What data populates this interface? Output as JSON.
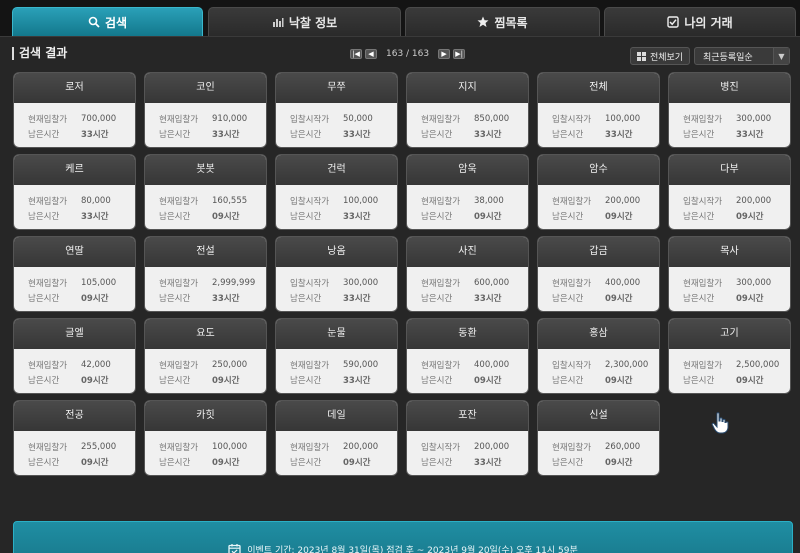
{
  "tabs": [
    {
      "label": "검색",
      "icon": "search-icon",
      "active": true
    },
    {
      "label": "낙찰 정보",
      "icon": "bar-chart-icon"
    },
    {
      "label": "찜목록",
      "icon": "star-icon"
    },
    {
      "label": "나의 거래",
      "icon": "checkbox-icon"
    }
  ],
  "panel": {
    "title": "검색 결과",
    "pager": {
      "text": "163 / 163",
      "first": "|◀",
      "prev": "◀",
      "next": "▶",
      "last": "▶|"
    },
    "view_all": "전체보기",
    "sort": "최근등록일순"
  },
  "items": [
    {
      "name": "로저",
      "price_label": "현재입찰가",
      "price": "700,000",
      "time_label": "남은시간",
      "time": "33시간"
    },
    {
      "name": "코인",
      "price_label": "현재입찰가",
      "price": "910,000",
      "time_label": "남은시간",
      "time": "33시간"
    },
    {
      "name": "무쭈",
      "price_label": "입찰시작가",
      "price": "50,000",
      "time_label": "남은시간",
      "time": "33시간"
    },
    {
      "name": "지지",
      "price_label": "현재입찰가",
      "price": "850,000",
      "time_label": "남은시간",
      "time": "33시간"
    },
    {
      "name": "전체",
      "price_label": "입찰시작가",
      "price": "100,000",
      "time_label": "남은시간",
      "time": "33시간"
    },
    {
      "name": "병진",
      "price_label": "현재입찰가",
      "price": "300,000",
      "time_label": "남은시간",
      "time": "33시간"
    },
    {
      "name": "케르",
      "price_label": "현재입찰가",
      "price": "80,000",
      "time_label": "남은시간",
      "time": "33시간"
    },
    {
      "name": "봇봇",
      "price_label": "현재입찰가",
      "price": "160,555",
      "time_label": "남은시간",
      "time": "09시간"
    },
    {
      "name": "건럭",
      "price_label": "입찰시작가",
      "price": "100,000",
      "time_label": "남은시간",
      "time": "33시간"
    },
    {
      "name": "암욱",
      "price_label": "현재입찰가",
      "price": "38,000",
      "time_label": "남은시간",
      "time": "09시간"
    },
    {
      "name": "암수",
      "price_label": "현재입찰가",
      "price": "200,000",
      "time_label": "남은시간",
      "time": "09시간"
    },
    {
      "name": "다부",
      "price_label": "입찰시작가",
      "price": "200,000",
      "time_label": "남은시간",
      "time": "09시간"
    },
    {
      "name": "연딸",
      "price_label": "현재입찰가",
      "price": "105,000",
      "time_label": "남은시간",
      "time": "09시간"
    },
    {
      "name": "전설",
      "price_label": "현재입찰가",
      "price": "2,999,999",
      "time_label": "남은시간",
      "time": "33시간"
    },
    {
      "name": "낭옴",
      "price_label": "입찰시작가",
      "price": "300,000",
      "time_label": "남은시간",
      "time": "33시간"
    },
    {
      "name": "사진",
      "price_label": "현재입찰가",
      "price": "600,000",
      "time_label": "남은시간",
      "time": "33시간"
    },
    {
      "name": "갑금",
      "price_label": "현재입찰가",
      "price": "400,000",
      "time_label": "남은시간",
      "time": "09시간"
    },
    {
      "name": "목사",
      "price_label": "현재입찰가",
      "price": "300,000",
      "time_label": "남은시간",
      "time": "09시간"
    },
    {
      "name": "글엘",
      "price_label": "현재입찰가",
      "price": "42,000",
      "time_label": "남은시간",
      "time": "09시간"
    },
    {
      "name": "요도",
      "price_label": "현재입찰가",
      "price": "250,000",
      "time_label": "남은시간",
      "time": "09시간"
    },
    {
      "name": "눈물",
      "price_label": "현재입찰가",
      "price": "590,000",
      "time_label": "남은시간",
      "time": "33시간"
    },
    {
      "name": "동환",
      "price_label": "현재입찰가",
      "price": "400,000",
      "time_label": "남은시간",
      "time": "09시간"
    },
    {
      "name": "홍삼",
      "price_label": "입찰시작가",
      "price": "2,300,000",
      "time_label": "남은시간",
      "time": "09시간"
    },
    {
      "name": "고기",
      "price_label": "현재입찰가",
      "price": "2,500,000",
      "time_label": "남은시간",
      "time": "09시간"
    },
    {
      "name": "전공",
      "price_label": "현재입찰가",
      "price": "255,000",
      "time_label": "남은시간",
      "time": "09시간"
    },
    {
      "name": "카힛",
      "price_label": "현재입찰가",
      "price": "100,000",
      "time_label": "남은시간",
      "time": "09시간"
    },
    {
      "name": "데일",
      "price_label": "현재입찰가",
      "price": "200,000",
      "time_label": "남은시간",
      "time": "09시간"
    },
    {
      "name": "포잔",
      "price_label": "입찰시작가",
      "price": "200,000",
      "time_label": "남은시간",
      "time": "33시간"
    },
    {
      "name": "신설",
      "price_label": "현재입찰가",
      "price": "260,000",
      "time_label": "남은시간",
      "time": "09시간"
    }
  ],
  "banner": {
    "text": "이벤트 기간: 2023년 8월 31일(목) 점검 후 ~ 2023년 9월 20일(수) 오후 11시 59분",
    "icon": "calendar-icon"
  }
}
